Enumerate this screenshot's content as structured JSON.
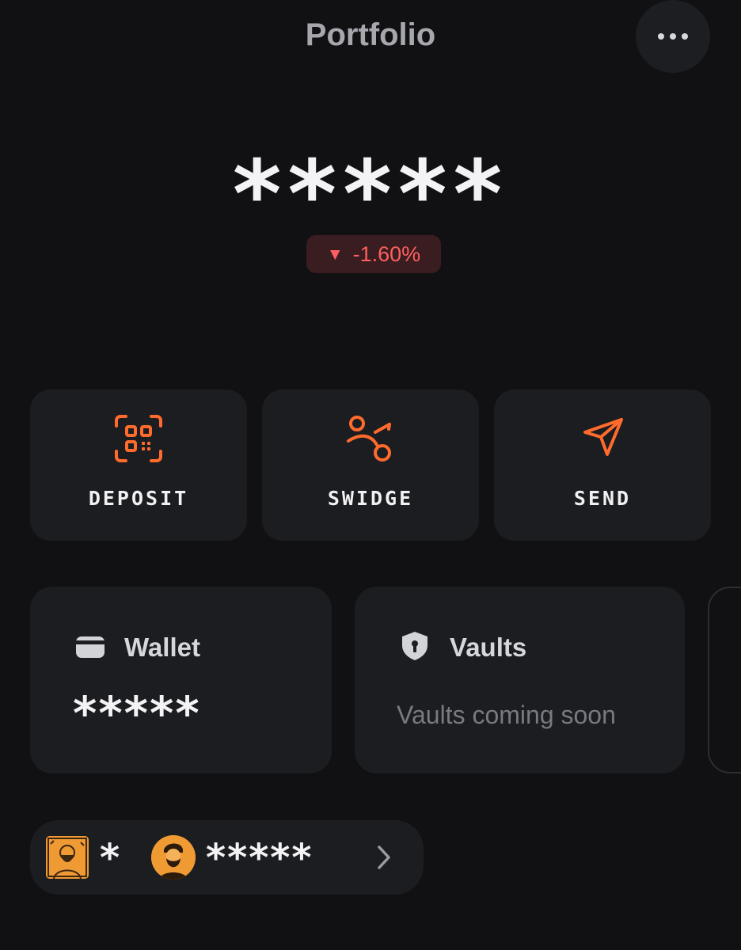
{
  "header": {
    "title": "Portfolio",
    "more_icon": "more-dots-icon"
  },
  "balance": {
    "value": "*****",
    "change": "-1.60%",
    "change_direction": "down",
    "change_color": "#ff5f61"
  },
  "actions": [
    {
      "label": "DEPOSIT",
      "icon": "qr-scan-icon"
    },
    {
      "label": "SWIDGE",
      "icon": "swap-bridge-icon"
    },
    {
      "label": "SEND",
      "icon": "send-arrow-icon"
    }
  ],
  "cards": {
    "wallet": {
      "title": "Wallet",
      "value": "*****",
      "icon": "wallet-icon"
    },
    "vaults": {
      "title": "Vaults",
      "subtitle": "Vaults coming soon",
      "icon": "shield-lock-icon"
    }
  },
  "bottom": {
    "nft_count": "*",
    "value": "*****",
    "avatar_one": "nft-avatar-square",
    "avatar_two": "nft-avatar-round",
    "chevron": "chevron-right-icon"
  },
  "colors": {
    "background": "#111114",
    "card": "#1c1d21",
    "accent": "#ff6b2c"
  }
}
